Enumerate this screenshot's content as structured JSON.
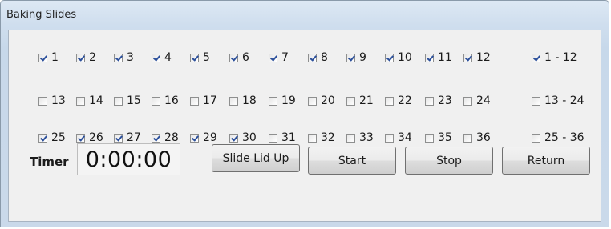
{
  "window": {
    "title": "Baking Slides"
  },
  "rows": [
    {
      "slides": [
        {
          "label": "1",
          "checked": true
        },
        {
          "label": "2",
          "checked": true
        },
        {
          "label": "3",
          "checked": true
        },
        {
          "label": "4",
          "checked": true
        },
        {
          "label": "5",
          "checked": true
        },
        {
          "label": "6",
          "checked": true
        },
        {
          "label": "7",
          "checked": true
        },
        {
          "label": "8",
          "checked": true
        },
        {
          "label": "9",
          "checked": true
        },
        {
          "label": "10",
          "checked": true
        },
        {
          "label": "11",
          "checked": true
        },
        {
          "label": "12",
          "checked": true
        }
      ],
      "group": {
        "label": "1 - 12",
        "checked": true
      }
    },
    {
      "slides": [
        {
          "label": "13",
          "checked": false
        },
        {
          "label": "14",
          "checked": false
        },
        {
          "label": "15",
          "checked": false
        },
        {
          "label": "16",
          "checked": false
        },
        {
          "label": "17",
          "checked": false
        },
        {
          "label": "18",
          "checked": false
        },
        {
          "label": "19",
          "checked": false
        },
        {
          "label": "20",
          "checked": false
        },
        {
          "label": "21",
          "checked": false
        },
        {
          "label": "22",
          "checked": false
        },
        {
          "label": "23",
          "checked": false
        },
        {
          "label": "24",
          "checked": false
        }
      ],
      "group": {
        "label": "13 - 24",
        "checked": false
      }
    },
    {
      "slides": [
        {
          "label": "25",
          "checked": true
        },
        {
          "label": "26",
          "checked": true
        },
        {
          "label": "27",
          "checked": true
        },
        {
          "label": "28",
          "checked": true
        },
        {
          "label": "29",
          "checked": true
        },
        {
          "label": "30",
          "checked": true
        },
        {
          "label": "31",
          "checked": false
        },
        {
          "label": "32",
          "checked": false
        },
        {
          "label": "33",
          "checked": false
        },
        {
          "label": "34",
          "checked": false
        },
        {
          "label": "35",
          "checked": false
        },
        {
          "label": "36",
          "checked": false
        }
      ],
      "group": {
        "label": "25 - 36",
        "checked": false
      }
    }
  ],
  "timer": {
    "label": "Timer",
    "value": "0:00:00"
  },
  "buttons": {
    "slide_lid_up": "Slide Lid Up",
    "start": "Start",
    "stop": "Stop",
    "return": "Return"
  }
}
